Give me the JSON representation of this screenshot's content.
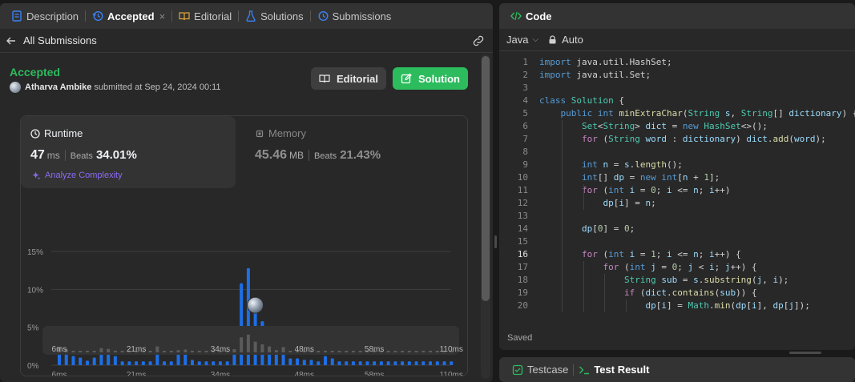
{
  "left_tabs": [
    {
      "label": "Description"
    },
    {
      "label": "Accepted"
    },
    {
      "label": "Editorial"
    },
    {
      "label": "Solutions"
    },
    {
      "label": "Submissions"
    }
  ],
  "close_glyph": "×",
  "back_label": "All Submissions",
  "status": "Accepted",
  "submitter": {
    "name": "Atharva Ambike",
    "text": "submitted at Sep 24, 2024 00:11"
  },
  "buttons": {
    "editorial": "Editorial",
    "solution": "Solution"
  },
  "runtime": {
    "label": "Runtime",
    "value": "47",
    "unit": "ms",
    "beats_label": "Beats",
    "beats": "34.01%",
    "analyze": "Analyze Complexity"
  },
  "memory": {
    "label": "Memory",
    "value": "45.46",
    "unit": "MB",
    "beats_label": "Beats",
    "beats": "21.43%"
  },
  "colors": {
    "accent_green": "#2cbb5d",
    "bar_blue": "#1e6fe6",
    "analyze_purple": "#8c6bf2"
  },
  "chart_data": {
    "type": "bar",
    "ylim": [
      0,
      15
    ],
    "y_ticks": [
      "0%",
      "5%",
      "10%",
      "15%"
    ],
    "x_tick_labels": [
      "6ms",
      "21ms",
      "34ms",
      "48ms",
      "58ms",
      "110ms"
    ],
    "x_tick_bar_index": [
      0,
      11,
      23,
      35,
      45,
      56
    ],
    "values": [
      4.0,
      2.5,
      1.2,
      1.0,
      0.6,
      1.0,
      3.0,
      2.5,
      1.2,
      0.5,
      0.5,
      0.5,
      0.5,
      0.5,
      4.3,
      0.5,
      0.5,
      1.6,
      2.0,
      0.7,
      0.5,
      0.5,
      0.5,
      0.5,
      0.5,
      2.3,
      10.8,
      12.8,
      7.7,
      5.8,
      4.3,
      1.6,
      3.8,
      0.9,
      0.9,
      0.7,
      0.7,
      0.5,
      1.2,
      0.9,
      0.5,
      0.5,
      0.5,
      0.5,
      0.5,
      0.5,
      0.5,
      0.5,
      0.5,
      0.5,
      0.5,
      0.5,
      0.5,
      0.5,
      0.5,
      0.5,
      0.5
    ],
    "highlight_index": 28,
    "grid": true
  },
  "code_panel": {
    "title": "Code",
    "language": "Java",
    "mode": "Auto",
    "status": "Saved"
  },
  "code_lines": [
    {
      "n": "1",
      "t": [
        [
          "k",
          "import "
        ],
        [
          "p",
          "java.util.HashSet;"
        ]
      ]
    },
    {
      "n": "2",
      "t": [
        [
          "k",
          "import "
        ],
        [
          "p",
          "java.util.Set;"
        ]
      ]
    },
    {
      "n": "3",
      "t": []
    },
    {
      "n": "4",
      "t": [
        [
          "k",
          "class "
        ],
        [
          "t",
          "Solution"
        ],
        [
          "p",
          " {"
        ]
      ]
    },
    {
      "n": "5",
      "t": [
        [
          "p",
          "    "
        ],
        [
          "k",
          "public int "
        ],
        [
          "f",
          "minExtraChar"
        ],
        [
          "p",
          "("
        ],
        [
          "t",
          "String "
        ],
        [
          "v",
          "s"
        ],
        [
          "p",
          ", "
        ],
        [
          "t",
          "String"
        ],
        [
          "p",
          "[] "
        ],
        [
          "v",
          "dictionary"
        ],
        [
          "p",
          ") {"
        ]
      ]
    },
    {
      "n": "6",
      "t": [
        [
          "p",
          "        "
        ],
        [
          "t",
          "Set"
        ],
        [
          "p",
          "<"
        ],
        [
          "t",
          "String"
        ],
        [
          "p",
          "> "
        ],
        [
          "v",
          "dict"
        ],
        [
          "p",
          " = "
        ],
        [
          "k",
          "new "
        ],
        [
          "t",
          "HashSet"
        ],
        [
          "p",
          "<>();"
        ]
      ]
    },
    {
      "n": "7",
      "t": [
        [
          "p",
          "        "
        ],
        [
          "c",
          "for "
        ],
        [
          "p",
          "("
        ],
        [
          "t",
          "String "
        ],
        [
          "v",
          "word"
        ],
        [
          "p",
          " : "
        ],
        [
          "v",
          "dictionary"
        ],
        [
          "p",
          ") "
        ],
        [
          "v",
          "dict"
        ],
        [
          "p",
          "."
        ],
        [
          "f",
          "add"
        ],
        [
          "p",
          "("
        ],
        [
          "v",
          "word"
        ],
        [
          "p",
          ");"
        ]
      ]
    },
    {
      "n": "8",
      "t": []
    },
    {
      "n": "9",
      "t": [
        [
          "p",
          "        "
        ],
        [
          "k",
          "int "
        ],
        [
          "v",
          "n"
        ],
        [
          "p",
          " = "
        ],
        [
          "v",
          "s"
        ],
        [
          "p",
          "."
        ],
        [
          "f",
          "length"
        ],
        [
          "p",
          "();"
        ]
      ]
    },
    {
      "n": "10",
      "t": [
        [
          "p",
          "        "
        ],
        [
          "k",
          "int"
        ],
        [
          "p",
          "[] "
        ],
        [
          "v",
          "dp"
        ],
        [
          "p",
          " = "
        ],
        [
          "k",
          "new int"
        ],
        [
          "p",
          "["
        ],
        [
          "v",
          "n"
        ],
        [
          "p",
          " + "
        ],
        [
          "n",
          "1"
        ],
        [
          "p",
          "];"
        ]
      ]
    },
    {
      "n": "11",
      "t": [
        [
          "p",
          "        "
        ],
        [
          "c",
          "for "
        ],
        [
          "p",
          "("
        ],
        [
          "k",
          "int "
        ],
        [
          "v",
          "i"
        ],
        [
          "p",
          " = "
        ],
        [
          "n",
          "0"
        ],
        [
          "p",
          "; "
        ],
        [
          "v",
          "i"
        ],
        [
          "p",
          " <= "
        ],
        [
          "v",
          "n"
        ],
        [
          "p",
          "; "
        ],
        [
          "v",
          "i"
        ],
        [
          "p",
          "++)"
        ]
      ]
    },
    {
      "n": "12",
      "t": [
        [
          "p",
          "            "
        ],
        [
          "v",
          "dp"
        ],
        [
          "p",
          "["
        ],
        [
          "v",
          "i"
        ],
        [
          "p",
          "] = "
        ],
        [
          "v",
          "n"
        ],
        [
          "p",
          ";"
        ]
      ]
    },
    {
      "n": "13",
      "t": []
    },
    {
      "n": "14",
      "t": [
        [
          "p",
          "        "
        ],
        [
          "v",
          "dp"
        ],
        [
          "p",
          "["
        ],
        [
          "n",
          "0"
        ],
        [
          "p",
          "] = "
        ],
        [
          "n",
          "0"
        ],
        [
          "p",
          ";"
        ]
      ]
    },
    {
      "n": "15",
      "t": []
    },
    {
      "n": "16",
      "t": [
        [
          "p",
          "        "
        ],
        [
          "c",
          "for "
        ],
        [
          "p",
          "("
        ],
        [
          "k",
          "int "
        ],
        [
          "v",
          "i"
        ],
        [
          "p",
          " = "
        ],
        [
          "n",
          "1"
        ],
        [
          "p",
          "; "
        ],
        [
          "v",
          "i"
        ],
        [
          "p",
          " <= "
        ],
        [
          "v",
          "n"
        ],
        [
          "p",
          "; "
        ],
        [
          "v",
          "i"
        ],
        [
          "p",
          "++) {"
        ]
      ]
    },
    {
      "n": "17",
      "t": [
        [
          "p",
          "            "
        ],
        [
          "c",
          "for "
        ],
        [
          "p",
          "("
        ],
        [
          "k",
          "int "
        ],
        [
          "v",
          "j"
        ],
        [
          "p",
          " = "
        ],
        [
          "n",
          "0"
        ],
        [
          "p",
          "; "
        ],
        [
          "v",
          "j"
        ],
        [
          "p",
          " < "
        ],
        [
          "v",
          "i"
        ],
        [
          "p",
          "; "
        ],
        [
          "v",
          "j"
        ],
        [
          "p",
          "++) {"
        ]
      ]
    },
    {
      "n": "18",
      "t": [
        [
          "p",
          "                "
        ],
        [
          "t",
          "String "
        ],
        [
          "v",
          "sub"
        ],
        [
          "p",
          " = "
        ],
        [
          "v",
          "s"
        ],
        [
          "p",
          "."
        ],
        [
          "f",
          "substring"
        ],
        [
          "p",
          "("
        ],
        [
          "v",
          "j"
        ],
        [
          "p",
          ", "
        ],
        [
          "v",
          "i"
        ],
        [
          "p",
          ");"
        ]
      ]
    },
    {
      "n": "19",
      "t": [
        [
          "p",
          "                "
        ],
        [
          "c",
          "if "
        ],
        [
          "p",
          "("
        ],
        [
          "v",
          "dict"
        ],
        [
          "p",
          "."
        ],
        [
          "f",
          "contains"
        ],
        [
          "p",
          "("
        ],
        [
          "v",
          "sub"
        ],
        [
          "p",
          ")) {"
        ]
      ]
    },
    {
      "n": "20",
      "t": [
        [
          "p",
          "                    "
        ],
        [
          "v",
          "dp"
        ],
        [
          "p",
          "["
        ],
        [
          "v",
          "i"
        ],
        [
          "p",
          "] = "
        ],
        [
          "t",
          "Math"
        ],
        [
          "p",
          "."
        ],
        [
          "f",
          "min"
        ],
        [
          "p",
          "("
        ],
        [
          "v",
          "dp"
        ],
        [
          "p",
          "["
        ],
        [
          "v",
          "i"
        ],
        [
          "p",
          "], "
        ],
        [
          "v",
          "dp"
        ],
        [
          "p",
          "["
        ],
        [
          "v",
          "j"
        ],
        [
          "p",
          "]);"
        ]
      ]
    }
  ],
  "current_line": "16",
  "bottom_tabs": [
    {
      "label": "Testcase"
    },
    {
      "label": "Test Result"
    }
  ]
}
